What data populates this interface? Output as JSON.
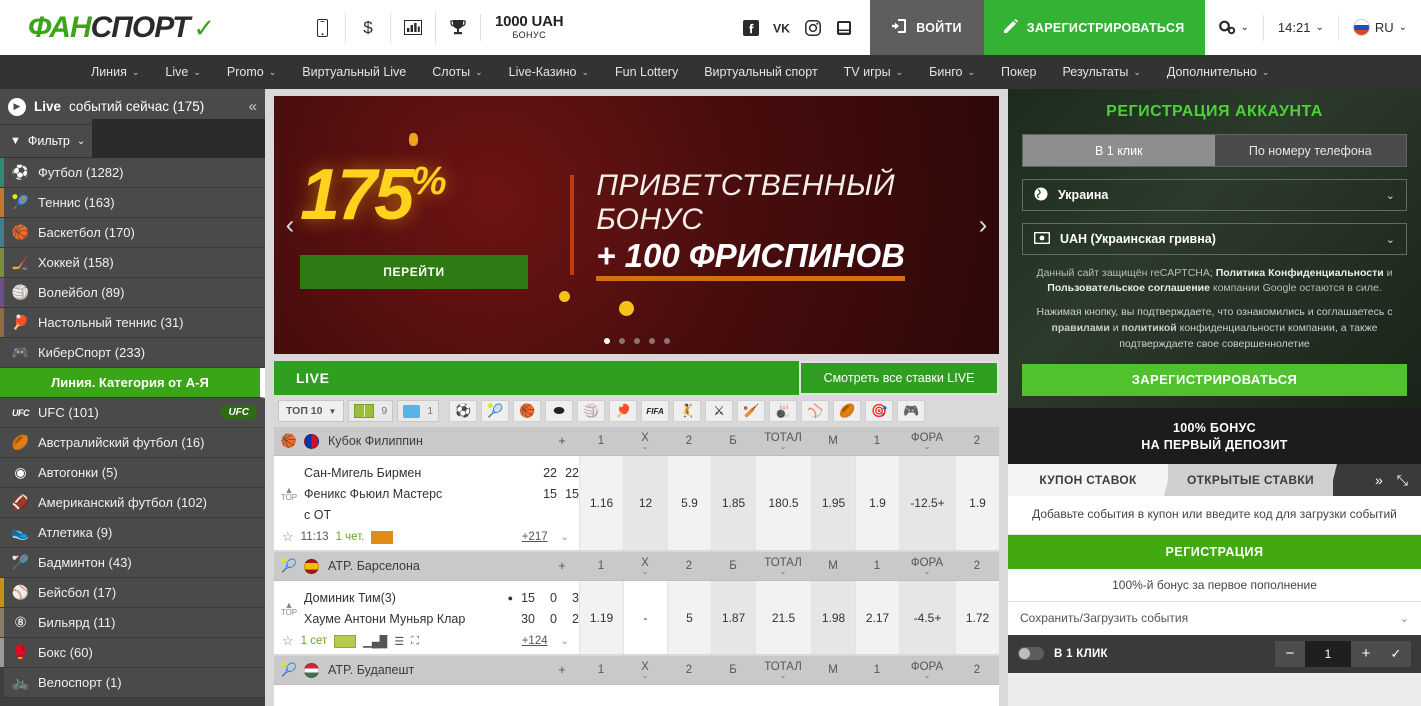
{
  "header": {
    "logo": {
      "part1": "ФАН",
      "part2": "СПОРТ",
      "mark": "✓"
    },
    "quick_icons": [
      {
        "name": "mobile-icon",
        "glyph": "▯"
      },
      {
        "name": "dollar-icon",
        "glyph": "$"
      },
      {
        "name": "stats-icon",
        "glyph": "▁▄█"
      },
      {
        "name": "trophy-icon",
        "glyph": "🏆"
      }
    ],
    "bonus": {
      "amount": "1000 UAH",
      "label": "БОНУС"
    },
    "social": [
      {
        "name": "facebook-icon",
        "glyph": "f"
      },
      {
        "name": "vk-icon",
        "glyph": "VK"
      },
      {
        "name": "instagram-icon",
        "glyph": "◉"
      },
      {
        "name": "youtube-icon",
        "glyph": "▶"
      }
    ],
    "login_label": "ВОЙТИ",
    "register_label": "ЗАРЕГИСТРИРОВАТЬСЯ",
    "settings_label": "",
    "time": "14:21",
    "lang": "RU"
  },
  "nav": [
    {
      "label": "Линия",
      "caret": true
    },
    {
      "label": "Live",
      "caret": true
    },
    {
      "label": "Promo",
      "caret": true
    },
    {
      "label": "Виртуальный Live",
      "caret": false
    },
    {
      "label": "Слоты",
      "caret": true
    },
    {
      "label": "Live-Казино",
      "caret": true
    },
    {
      "label": "Fun Lottery",
      "caret": false
    },
    {
      "label": "Виртуальный спорт",
      "caret": false
    },
    {
      "label": "TV игры",
      "caret": true
    },
    {
      "label": "Бинго",
      "caret": true
    },
    {
      "label": "Покер",
      "caret": false
    },
    {
      "label": "Результаты",
      "caret": true
    },
    {
      "label": "Дополнительно",
      "caret": true
    }
  ],
  "sidebar": {
    "header": {
      "live_bold": "Live",
      "rest": "событий сейчас (175)",
      "collapse": "«"
    },
    "filter": {
      "label": "Фильтр",
      "caret": "⌄"
    },
    "live_sports": [
      {
        "label": "Футбол (1282)",
        "icon": "football-icon",
        "glyph": "⚽",
        "accent": "#2e8b72"
      },
      {
        "label": "Теннис (163)",
        "icon": "tennis-icon",
        "glyph": "🎾",
        "accent": "#c4762a"
      },
      {
        "label": "Баскетбол (170)",
        "icon": "basketball-icon",
        "glyph": "🏀",
        "accent": "#3d7f8c"
      },
      {
        "label": "Хоккей (158)",
        "icon": "hockey-icon",
        "glyph": "🏒",
        "accent": "#7d8c3d"
      },
      {
        "label": "Волейбол (89)",
        "icon": "volleyball-icon",
        "glyph": "🏐",
        "accent": "#6d4f8c"
      },
      {
        "label": "Настольный теннис (31)",
        "icon": "table-tennis-icon",
        "glyph": "🏓",
        "accent": "#8c6d3d"
      },
      {
        "label": "КиберСпорт (233)",
        "icon": "esports-icon",
        "glyph": "🎮",
        "accent": "#4a4a4a"
      }
    ],
    "section_title": "Линия. Категория от А-Я",
    "line_sports": [
      {
        "label": "UFC (101)",
        "icon": "ufc-icon",
        "glyph": "UFC",
        "accent": "#4a4a4a",
        "badge": "UFC"
      },
      {
        "label": "Австралийский футбол (16)",
        "icon": "aussie-rules-icon",
        "glyph": "🏉",
        "accent": "#4a4a4a"
      },
      {
        "label": "Автогонки (5)",
        "icon": "motorsport-icon",
        "glyph": "◉",
        "accent": "#4a4a4a"
      },
      {
        "label": "Американский футбол (102)",
        "icon": "american-football-icon",
        "glyph": "🏈",
        "accent": "#4a4a4a"
      },
      {
        "label": "Атлетика (9)",
        "icon": "athletics-icon",
        "glyph": "👟",
        "accent": "#4a4a4a"
      },
      {
        "label": "Бадминтон (43)",
        "icon": "badminton-icon",
        "glyph": "🏸",
        "accent": "#4a4a4a"
      },
      {
        "label": "Бейсбол (17)",
        "icon": "baseball-icon",
        "glyph": "⚾",
        "accent": "#c59216"
      },
      {
        "label": "Бильярд (11)",
        "icon": "billiards-icon",
        "glyph": "⑧",
        "accent": "#8a7e6b"
      },
      {
        "label": "Бокс (60)",
        "icon": "boxing-icon",
        "glyph": "🥊",
        "accent": "#9a9a9a"
      },
      {
        "label": "Велоспорт (1)",
        "icon": "cycling-icon",
        "glyph": "🚲",
        "accent": "#3f3f3f"
      }
    ]
  },
  "banner": {
    "percent": "175",
    "percent_sup": "%",
    "line1": "ПРИВЕТСТВЕННЫЙ БОНУС",
    "line2": "+ 100 ФРИСПИНОВ",
    "cta": "ПЕРЕЙТИ",
    "prev": "‹",
    "next": "›",
    "dots": 5,
    "active_dot": 0
  },
  "live": {
    "title": "LIVE",
    "all_bets_label": "Смотреть все ставки LIVE",
    "filters": {
      "top10": "ТОП 10",
      "pitch_count": "9",
      "monitor_count": "1",
      "sport_icons": [
        {
          "name": "football-icon",
          "glyph": "⚽"
        },
        {
          "name": "tennis-icon",
          "glyph": "🎾"
        },
        {
          "name": "basketball-icon",
          "glyph": "🏀"
        },
        {
          "name": "hockey-puck-icon",
          "glyph": "⬬"
        },
        {
          "name": "volleyball-icon",
          "glyph": "🏐"
        },
        {
          "name": "table-tennis-icon",
          "glyph": "🏓"
        },
        {
          "name": "fifa-icon",
          "glyph": "FIFA"
        },
        {
          "name": "handball-icon",
          "glyph": "🤾"
        },
        {
          "name": "esports-dota-icon",
          "glyph": "⚔"
        },
        {
          "name": "cricket-icon",
          "glyph": "🏏"
        },
        {
          "name": "bowling-icon",
          "glyph": "🎳"
        },
        {
          "name": "baseball-icon",
          "glyph": "⚾"
        },
        {
          "name": "rugby-icon",
          "glyph": "🏉"
        },
        {
          "name": "darts-icon",
          "glyph": "🎯"
        },
        {
          "name": "esports-pad-icon",
          "glyph": "🎮"
        }
      ]
    },
    "columns": [
      {
        "label": "1",
        "caret": false,
        "wide": false
      },
      {
        "label": "X",
        "caret": true,
        "wide": false
      },
      {
        "label": "2",
        "caret": false,
        "wide": false
      },
      {
        "label": "Б",
        "caret": false,
        "wide": false
      },
      {
        "label": "ТОТАЛ",
        "caret": true,
        "wide": true
      },
      {
        "label": "М",
        "caret": false,
        "wide": false
      },
      {
        "label": "1",
        "caret": false,
        "wide": false
      },
      {
        "label": "ФОРА",
        "caret": true,
        "wide": true
      },
      {
        "label": "2",
        "caret": false,
        "wide": false
      }
    ],
    "plus_label": "+",
    "leagues": [
      {
        "sport_icon": "basketball-icon",
        "sport_glyph": "🏀",
        "flag": "philippines-flag",
        "flag_css": "linear-gradient(90deg,#0038a8 0 50%,#ce1126 50% 100%)",
        "name": "Кубок Филиппин",
        "matches": [
          {
            "top_label": "TOP",
            "teams": [
              {
                "name": "Сан-Мигель Бирмен",
                "scores": [
                  "22",
                  "22"
                ]
              },
              {
                "name": "Феникс Фьюил Мастерс",
                "scores": [
                  "15",
                  "15"
                ]
              }
            ],
            "extra_line": "с ОТ",
            "time": "11:13",
            "period": "1 чет.",
            "more": "+217",
            "odds": [
              "1.16",
              "12",
              "5.9",
              "1.85",
              "180.5",
              "1.95",
              "1.9",
              "-12.5+",
              "1.9"
            ]
          }
        ]
      },
      {
        "sport_icon": "tennis-icon",
        "sport_glyph": "🎾",
        "flag": "spain-flag",
        "flag_css": "linear-gradient(#aa151b 0 25%,#f1bf00 25% 75%,#aa151b 75% 100%)",
        "name": "ATP. Барселона",
        "matches": [
          {
            "top_label": "TOP",
            "teams": [
              {
                "name": "Доминик Тим(3)",
                "scores": [
                  "15",
                  "0",
                  "3"
                ],
                "serving": true
              },
              {
                "name": "Хауме Антони Муньяр Клар",
                "scores": [
                  "30",
                  "0",
                  "2"
                ]
              }
            ],
            "extra_line": "",
            "time": "",
            "period": "1 сет",
            "more": "+124",
            "odds": [
              "1.19",
              "-",
              "5",
              "1.87",
              "21.5",
              "1.98",
              "2.17",
              "-4.5+",
              "1.72"
            ]
          }
        ]
      },
      {
        "sport_icon": "tennis-icon",
        "sport_glyph": "🎾",
        "flag": "hungary-flag",
        "flag_css": "linear-gradient(#ce2939 0 33%,#fff 33% 66%,#477050 66% 100%)",
        "name": "ATP. Будапешт",
        "matches": []
      }
    ]
  },
  "registration": {
    "title": "РЕГИСТРАЦИЯ АККАУНТА",
    "tabs": [
      {
        "label": "В 1 клик",
        "active": true
      },
      {
        "label": "По номеру телефона",
        "active": false
      }
    ],
    "country": {
      "value": "Украина",
      "icon": "globe-icon"
    },
    "currency": {
      "value": "UAH (Украинская гривна)",
      "icon": "banknote-icon"
    },
    "legal_1": "Данный сайт защищён reCAPTCHA; ",
    "legal_1b": "Политика Конфиденциальности",
    "legal_1c": " и ",
    "legal_1d": "Пользовательское соглашение",
    "legal_1e": " компании Google остаются в силе.",
    "legal_2a": "Нажимая кнопку, вы подтверждаете, что ознакомились и соглашаетесь с ",
    "legal_2b": "правилами",
    "legal_2c": " и ",
    "legal_2d": "политикой",
    "legal_2e": " конфиденциальности компании, а также подтверждаете свое совершеннолетие",
    "submit_label": "ЗАРЕГИСТРИРОВАТЬСЯ",
    "deposit_l1": "100% БОНУС",
    "deposit_l2": "НА ПЕРВЫЙ ДЕПОЗИТ"
  },
  "coupon": {
    "tabs": [
      {
        "label": "КУПОН СТАВОК",
        "active": true
      },
      {
        "label": "ОТКРЫТЫЕ СТАВКИ",
        "active": false
      }
    ],
    "expand_icon": "»",
    "collapse_icon": "⤡",
    "empty_message": "Добавьте события в купон или введите код для загрузки событий",
    "register_label": "РЕГИСТРАЦИЯ",
    "bonus_note": "100%-й бонус за первое пополнение",
    "save_load": "Сохранить/Загрузить события",
    "footer": {
      "one_click_label": "В 1 КЛИК",
      "minus": "−",
      "value": "1",
      "plus": "+",
      "confirm": "✓"
    }
  }
}
